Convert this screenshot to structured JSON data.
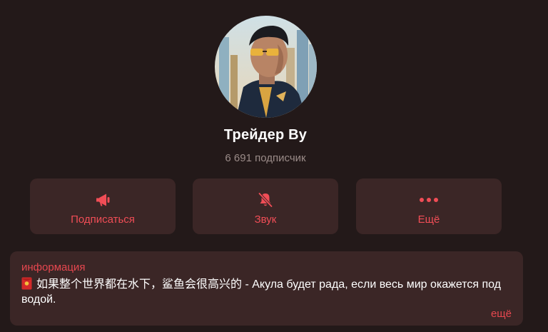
{
  "channel": {
    "title": "Трейдер Ву",
    "subscribers": "6 691 подписчик"
  },
  "actions": {
    "subscribe": {
      "label": "Подписаться",
      "icon": "megaphone-icon"
    },
    "sound": {
      "label": "Звук",
      "icon": "bell-muted-icon"
    },
    "more": {
      "label": "Ещё",
      "icon": "more-dots-icon"
    }
  },
  "info": {
    "heading": "информация",
    "icon": "red-envelope-icon",
    "text": "如果整个世界都在水下，鲨鱼会很高兴的 - Акула будет рада, если весь мир окажется под водой.",
    "more_label": "ещё"
  },
  "colors": {
    "background": "#231919",
    "card": "#3b2626",
    "accent": "#f04d56",
    "muted_text": "#9a8b88"
  }
}
